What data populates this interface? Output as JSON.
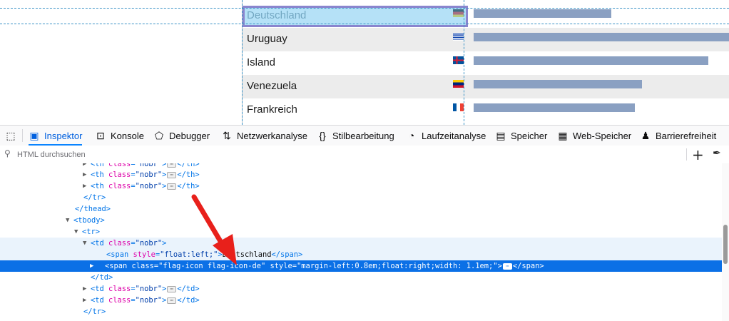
{
  "page": {
    "rows": [
      {
        "country": "Deutschland",
        "flag": "de",
        "bar": 0.54,
        "alt": false,
        "highlight": true
      },
      {
        "country": "Uruguay",
        "flag": "uy",
        "bar": 1.0,
        "alt": true,
        "highlight": false
      },
      {
        "country": "Island",
        "flag": "is",
        "bar": 0.92,
        "alt": false,
        "highlight": false
      },
      {
        "country": "Venezuela",
        "flag": "ve",
        "bar": 0.66,
        "alt": true,
        "highlight": false
      },
      {
        "country": "Frankreich",
        "flag": "fr",
        "bar": 0.63,
        "alt": false,
        "highlight": false
      }
    ],
    "bar_color": "#8aa0c2"
  },
  "toolbar": {
    "pick_icon": "element-picker-icon",
    "tabs": [
      {
        "label": "Inspektor",
        "icon": "inspector-icon",
        "active": true
      },
      {
        "label": "Konsole",
        "icon": "console-icon",
        "active": false
      },
      {
        "label": "Debugger",
        "icon": "debugger-icon",
        "active": false
      },
      {
        "label": "Netzwerkanalyse",
        "icon": "network-icon",
        "active": false
      },
      {
        "label": "Stilbearbeitung",
        "icon": "style-editor-icon",
        "active": false
      },
      {
        "label": "Laufzeitanalyse",
        "icon": "performance-icon",
        "active": false
      },
      {
        "label": "Speicher",
        "icon": "memory-icon",
        "active": false
      },
      {
        "label": "Web-Speicher",
        "icon": "storage-icon",
        "active": false
      },
      {
        "label": "Barrierefreiheit",
        "icon": "accessibility-icon",
        "active": false
      }
    ]
  },
  "search": {
    "placeholder": "HTML durchsuchen",
    "add_icon": "add-node-icon",
    "eyedropper_icon": "eyedropper-icon"
  },
  "markup": {
    "lines": [
      {
        "tag": "th",
        "cls": "nobr",
        "kind": "collapsed-el"
      },
      {
        "tag": "th",
        "cls": "nobr",
        "kind": "collapsed-el"
      },
      {
        "tag": "th",
        "cls": "nobr",
        "kind": "collapsed-el"
      },
      {
        "text": "</tr>",
        "kind": "close"
      },
      {
        "text": "</thead>",
        "kind": "close"
      },
      {
        "text": "<tbody>",
        "kind": "open"
      },
      {
        "text": "<tr>",
        "kind": "open"
      },
      {
        "tag": "td",
        "cls": "nobr",
        "kind": "open-el"
      },
      {
        "span_style": "float:left;",
        "span_text": "Deutschland",
        "kind": "span-text"
      },
      {
        "span_class": "flag-icon flag-icon-de",
        "span_style2": "margin-left:0.8em;float:right;width: 1.1em;",
        "kind": "span-selected"
      },
      {
        "text": "</td>",
        "kind": "close"
      },
      {
        "tag": "td",
        "cls": "nobr",
        "kind": "collapsed-el"
      },
      {
        "tag": "td",
        "cls": "nobr",
        "kind": "collapsed-el"
      },
      {
        "text": "</tr>",
        "kind": "close"
      }
    ],
    "selected_color": "#0b70e6"
  }
}
